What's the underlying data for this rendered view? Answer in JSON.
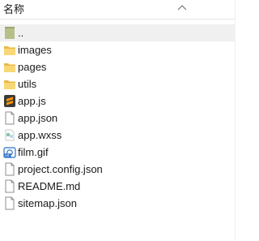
{
  "header": {
    "name_column_label": "名称",
    "sort_icon": "chevron-up-icon"
  },
  "files": [
    {
      "label": "..",
      "icon": "parent-folder-icon",
      "selected": true
    },
    {
      "label": "images",
      "icon": "folder-icon"
    },
    {
      "label": "pages",
      "icon": "folder-icon"
    },
    {
      "label": "utils",
      "icon": "folder-icon"
    },
    {
      "label": "app.js",
      "icon": "sublime-text-file-icon"
    },
    {
      "label": "app.json",
      "icon": "generic-file-icon"
    },
    {
      "label": "app.wxss",
      "icon": "wxss-file-icon"
    },
    {
      "label": "film.gif",
      "icon": "gif-image-file-icon"
    },
    {
      "label": "project.config.json",
      "icon": "generic-file-icon"
    },
    {
      "label": "README.md",
      "icon": "generic-file-icon"
    },
    {
      "label": "sitemap.json",
      "icon": "generic-file-icon"
    }
  ],
  "colors": {
    "folder": "#f8d775",
    "folder_dark": "#e8b94a",
    "parent_folder": "#b5bf8a",
    "selected_row": "#f0f0f0",
    "sublime_bg": "#3b3b3b",
    "sublime_accent": "#ff9800",
    "gif_blue": "#2b6fc7"
  }
}
